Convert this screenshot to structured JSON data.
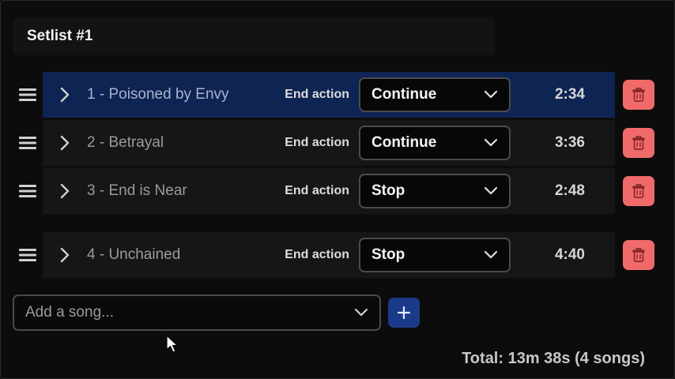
{
  "setlist": {
    "title": "Setlist #1"
  },
  "songs": [
    {
      "title": "1 - Poisoned by Envy",
      "end_action_label": "End action",
      "end_action": "Continue",
      "duration": "2:34",
      "active": true
    },
    {
      "title": "2 - Betrayal",
      "end_action_label": "End action",
      "end_action": "Continue",
      "duration": "3:36",
      "active": false
    },
    {
      "title": "3 - End is Near",
      "end_action_label": "End action",
      "end_action": "Stop",
      "duration": "2:48",
      "active": false
    },
    {
      "title": "4 - Unchained",
      "end_action_label": "End action",
      "end_action": "Stop",
      "duration": "4:40",
      "active": false
    }
  ],
  "add_song": {
    "placeholder": "Add a song..."
  },
  "footer": {
    "total": "Total: 13m 38s (4 songs)"
  },
  "colors": {
    "active_row": "#0e2453",
    "delete_button": "#f06a6a",
    "add_button": "#1c3a8a"
  },
  "icons": {
    "drag": "drag-handle-icon",
    "expand": "chevron-right-icon",
    "dropdown": "chevron-down-icon",
    "delete": "trash-icon",
    "add": "plus-icon"
  }
}
